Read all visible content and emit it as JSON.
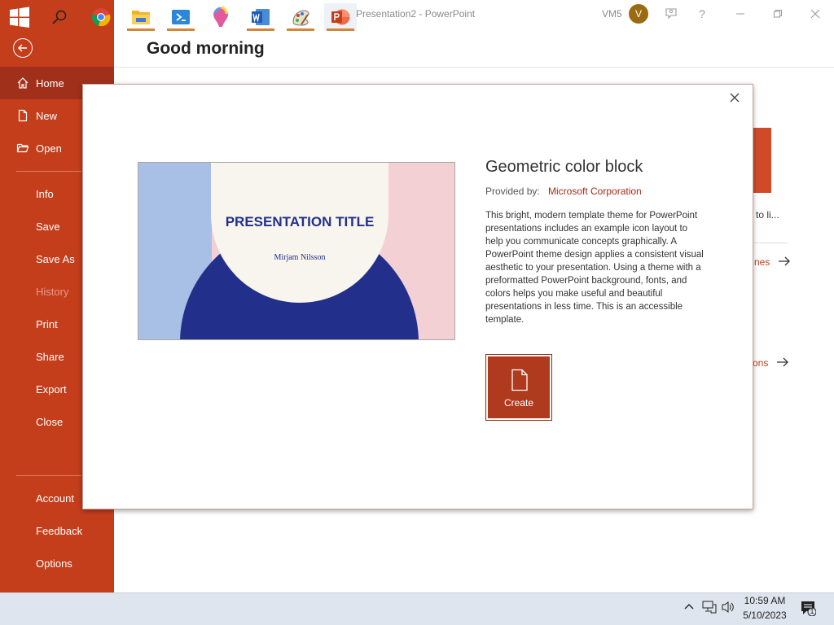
{
  "window": {
    "title": "Presentation2  -  PowerPoint",
    "user": "VM5",
    "avatar_initial": "V"
  },
  "nav": {
    "items": [
      {
        "label": "Home",
        "icon": "home-icon",
        "selected": true
      },
      {
        "label": "New",
        "icon": "new-document-icon"
      },
      {
        "label": "Open",
        "icon": "folder-open-icon"
      },
      {
        "label": "Info"
      },
      {
        "label": "Save"
      },
      {
        "label": "Save As"
      },
      {
        "label": "History",
        "disabled": true
      },
      {
        "label": "Print"
      },
      {
        "label": "Share"
      },
      {
        "label": "Export"
      },
      {
        "label": "Close"
      }
    ],
    "bottom_items": [
      {
        "label": "Account"
      },
      {
        "label": "Feedback"
      },
      {
        "label": "Options"
      }
    ]
  },
  "main": {
    "greeting": "Good morning",
    "partial_texts": [
      "to li...",
      "nes",
      "ons"
    ]
  },
  "dialog": {
    "preview": {
      "title": "PRESENTATION TITLE",
      "subtitle": "Mirjam Nilsson"
    },
    "template_title": "Geometric color block",
    "provided_by_label": "Provided by:",
    "provided_by_value": "Microsoft Corporation",
    "description": "This bright, modern template theme for PowerPoint presentations includes an example icon layout to help you communicate concepts graphically. A PowerPoint theme design applies a consistent visual aesthetic to your presentation. Using a theme with a preformatted PowerPoint background, fonts, and colors helps you make useful and beautiful presentations in less time. This is an accessible template.",
    "create_label": "Create"
  },
  "taskbar": {
    "apps": [
      "start-icon",
      "search-icon",
      "chrome-icon",
      "file-explorer-icon",
      "remote-desktop-icon",
      "paint-3d-icon",
      "word-icon",
      "paint-icon",
      "powerpoint-icon"
    ],
    "time": "10:59 AM",
    "date": "5/10/2023",
    "notification_count": "1"
  },
  "colors": {
    "accent": "#c43e1c",
    "selected_nav": "#a1301a",
    "create_button": "#b03a1e",
    "preview_navy": "#22308c"
  }
}
